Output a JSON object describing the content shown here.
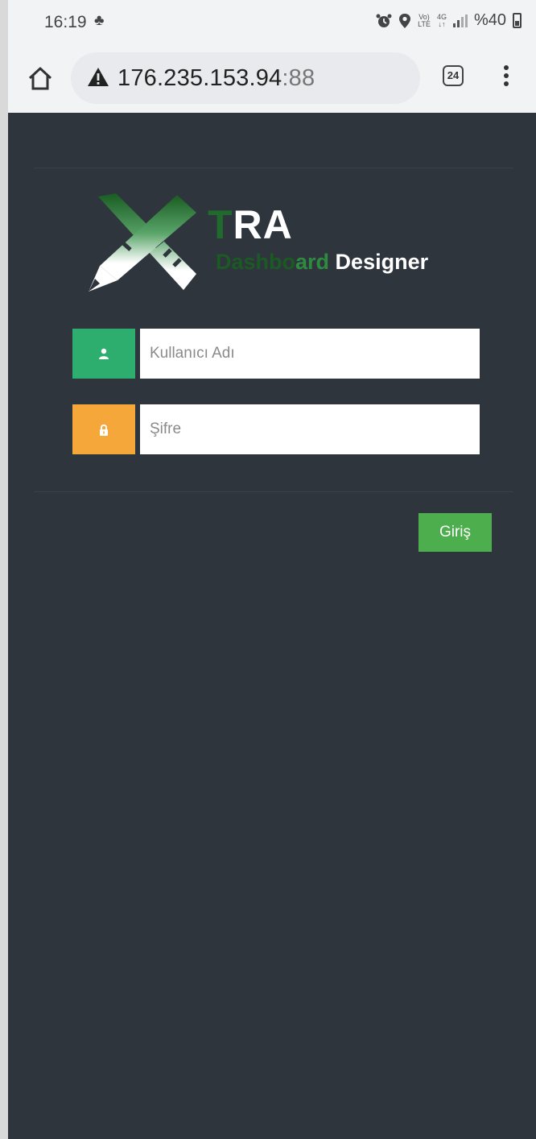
{
  "status_bar": {
    "time": "16:19",
    "notification_glyph": "♣",
    "volte_top": "Vo)",
    "volte_bottom": "LTE",
    "net_top": "4G",
    "net_bottom": "↓↑",
    "battery": "%40"
  },
  "browser": {
    "url_host": "176.235.153.94",
    "url_port": ":88",
    "tab_count": "24"
  },
  "logo": {
    "title_first": "T",
    "title_rest": "RA",
    "subtitle_hidden": "Dashbo",
    "subtitle_accent": "ard",
    "subtitle_end": " Designer"
  },
  "form": {
    "username_placeholder": "Kullanıcı Adı",
    "password_placeholder": "Şifre",
    "login_label": "Giriş"
  },
  "colors": {
    "page_bg": "#2f353d",
    "user_addon": "#2eae6e",
    "password_addon": "#f6a73a",
    "login_button": "#4cae4c"
  },
  "icons": {
    "home": "home-icon",
    "warning": "warning-triangle-icon",
    "tabs": "tabs-icon",
    "menu": "more-vert-icon",
    "user": "user-icon",
    "lock": "lock-icon",
    "alarm": "alarm-icon",
    "location": "location-icon"
  }
}
